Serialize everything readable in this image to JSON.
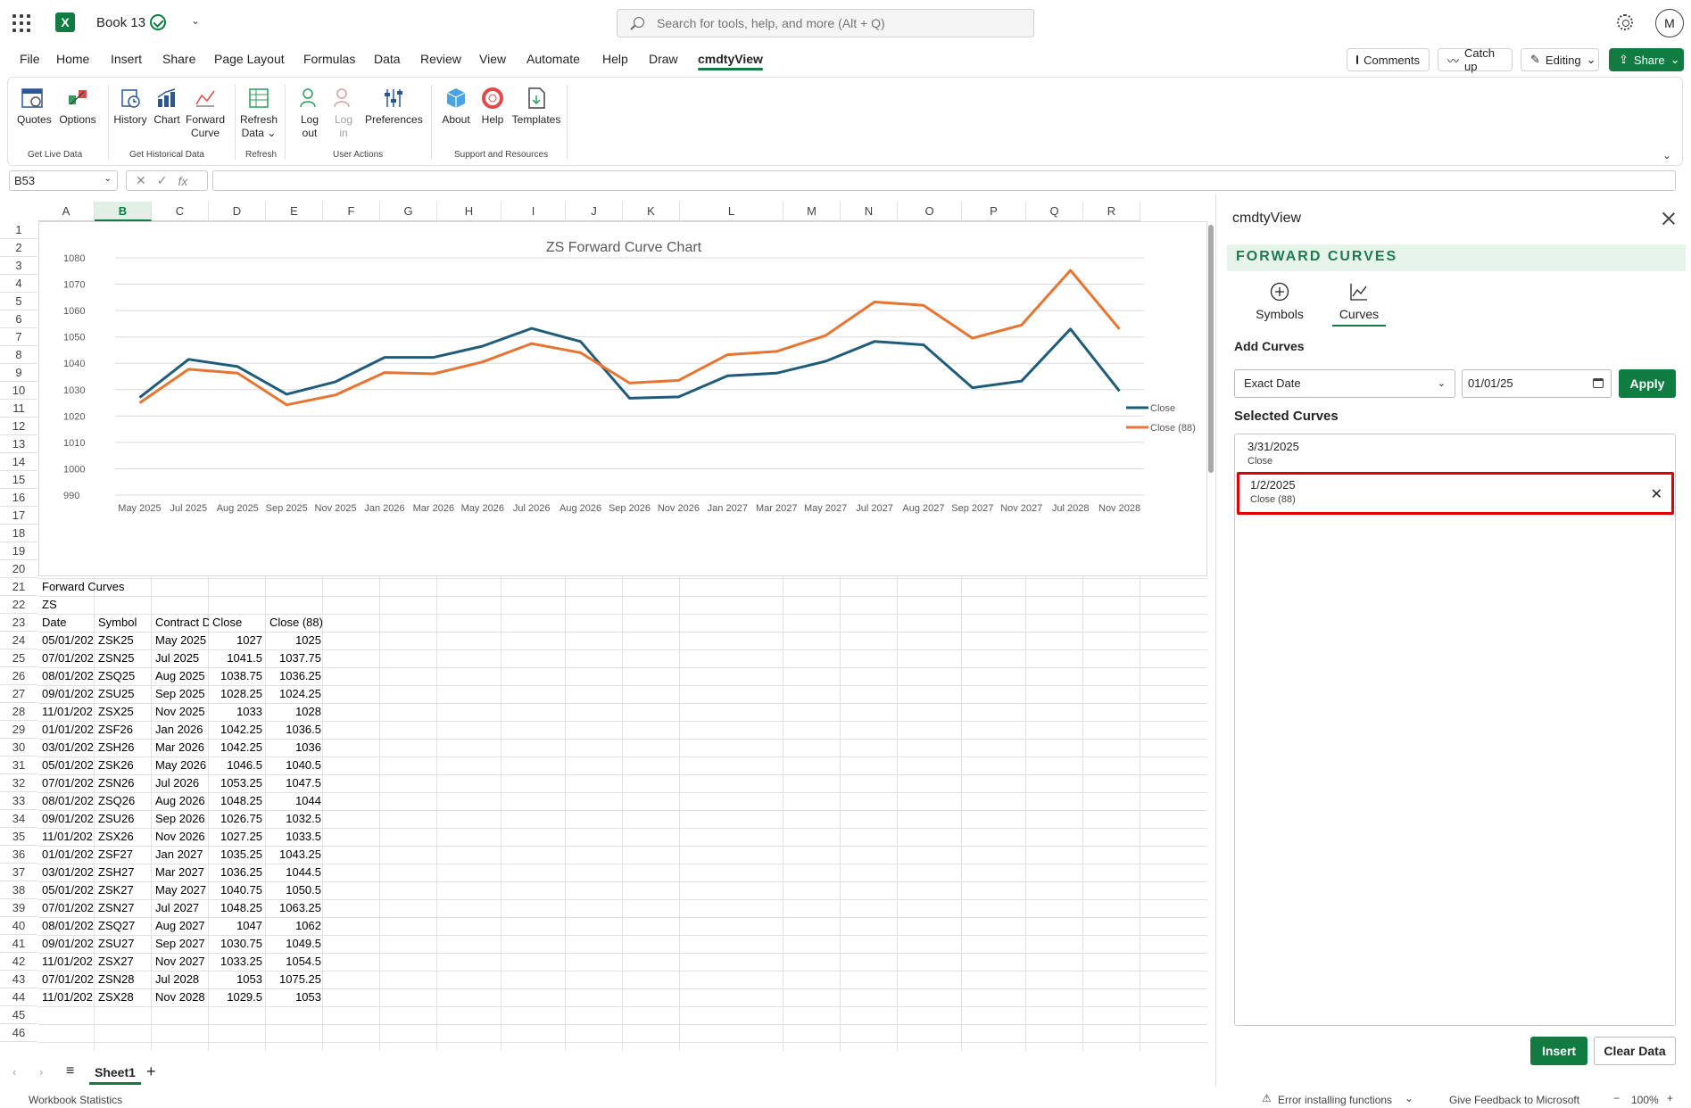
{
  "titlebar": {
    "book_title": "Book 13",
    "search_placeholder": "Search for tools, help, and more (Alt + Q)",
    "avatar_initial": "M"
  },
  "menu": {
    "tabs": [
      "File",
      "Home",
      "Insert",
      "Share",
      "Page Layout",
      "Formulas",
      "Data",
      "Review",
      "View",
      "Automate",
      "Help",
      "Draw",
      "cmdtyView"
    ],
    "active_tab": "cmdtyView",
    "comments": "Comments",
    "catch_up": "Catch up",
    "editing": "Editing",
    "share": "Share"
  },
  "ribbon": {
    "quotes": "Quotes",
    "options": "Options",
    "history": "History",
    "chart": "Chart",
    "forward": "Forward",
    "curve": "Curve",
    "refresh": "Refresh",
    "data": "Data",
    "log": "Log",
    "out": "out",
    "login_log": "Log",
    "login_in": "in",
    "preferences": "Preferences",
    "about": "About",
    "help": "Help",
    "templates": "Templates",
    "groups": {
      "live": "Get Live Data",
      "historical": "Get Historical Data",
      "refresh": "Refresh",
      "user": "User Actions",
      "support": "Support and Resources"
    }
  },
  "formula": {
    "namebox": "B53",
    "value": ""
  },
  "columns": [
    "A",
    "B",
    "C",
    "D",
    "E",
    "F",
    "G",
    "H",
    "I",
    "J",
    "K",
    "L",
    "M",
    "N",
    "O",
    "P",
    "Q",
    "R"
  ],
  "selected_column": "B",
  "sheet": {
    "row21": "Forward Curves",
    "row22": "ZS",
    "headers": [
      "Date",
      "Symbol",
      "Contract D",
      "Close",
      "Close (88)"
    ],
    "rows": [
      [
        "05/01/202",
        "ZSK25",
        "May 2025",
        "1027",
        "1025"
      ],
      [
        "07/01/202",
        "ZSN25",
        "Jul 2025",
        "1041.5",
        "1037.75"
      ],
      [
        "08/01/202",
        "ZSQ25",
        "Aug 2025",
        "1038.75",
        "1036.25"
      ],
      [
        "09/01/202",
        "ZSU25",
        "Sep 2025",
        "1028.25",
        "1024.25"
      ],
      [
        "11/01/202",
        "ZSX25",
        "Nov 2025",
        "1033",
        "1028"
      ],
      [
        "01/01/202",
        "ZSF26",
        "Jan 2026",
        "1042.25",
        "1036.5"
      ],
      [
        "03/01/202",
        "ZSH26",
        "Mar 2026",
        "1042.25",
        "1036"
      ],
      [
        "05/01/202",
        "ZSK26",
        "May 2026",
        "1046.5",
        "1040.5"
      ],
      [
        "07/01/202",
        "ZSN26",
        "Jul 2026",
        "1053.25",
        "1047.5"
      ],
      [
        "08/01/202",
        "ZSQ26",
        "Aug 2026",
        "1048.25",
        "1044"
      ],
      [
        "09/01/202",
        "ZSU26",
        "Sep 2026",
        "1026.75",
        "1032.5"
      ],
      [
        "11/01/202",
        "ZSX26",
        "Nov 2026",
        "1027.25",
        "1033.5"
      ],
      [
        "01/01/202",
        "ZSF27",
        "Jan 2027",
        "1035.25",
        "1043.25"
      ],
      [
        "03/01/202",
        "ZSH27",
        "Mar 2027",
        "1036.25",
        "1044.5"
      ],
      [
        "05/01/202",
        "ZSK27",
        "May 2027",
        "1040.75",
        "1050.5"
      ],
      [
        "07/01/202",
        "ZSN27",
        "Jul 2027",
        "1048.25",
        "1063.25"
      ],
      [
        "08/01/202",
        "ZSQ27",
        "Aug 2027",
        "1047",
        "1062"
      ],
      [
        "09/01/202",
        "ZSU27",
        "Sep 2027",
        "1030.75",
        "1049.5"
      ],
      [
        "11/01/202",
        "ZSX27",
        "Nov 2027",
        "1033.25",
        "1054.5"
      ],
      [
        "07/01/202",
        "ZSN28",
        "Jul 2028",
        "1053",
        "1075.25"
      ],
      [
        "11/01/202",
        "ZSX28",
        "Nov 2028",
        "1029.5",
        "1053"
      ]
    ]
  },
  "chart_data": {
    "type": "line",
    "title": "ZS Forward Curve Chart",
    "categories": [
      "May 2025",
      "Jul 2025",
      "Aug 2025",
      "Sep 2025",
      "Nov 2025",
      "Jan 2026",
      "Mar 2026",
      "May 2026",
      "Jul 2026",
      "Aug 2026",
      "Sep 2026",
      "Nov 2026",
      "Jan 2027",
      "Mar 2027",
      "May 2027",
      "Jul 2027",
      "Aug 2027",
      "Sep 2027",
      "Nov 2027",
      "Jul 2028",
      "Nov 2028"
    ],
    "series": [
      {
        "name": "Close",
        "color": "#1f5c7a",
        "values": [
          1027,
          1041.5,
          1038.75,
          1028.25,
          1033,
          1042.25,
          1042.25,
          1046.5,
          1053.25,
          1048.25,
          1026.75,
          1027.25,
          1035.25,
          1036.25,
          1040.75,
          1048.25,
          1047,
          1030.75,
          1033.25,
          1053,
          1029.5
        ]
      },
      {
        "name": "Close (88)",
        "color": "#e87432",
        "values": [
          1025,
          1037.75,
          1036.25,
          1024.25,
          1028,
          1036.5,
          1036,
          1040.5,
          1047.5,
          1044,
          1032.5,
          1033.5,
          1043.25,
          1044.5,
          1050.5,
          1063.25,
          1062,
          1049.5,
          1054.5,
          1075.25,
          1053
        ]
      }
    ],
    "ylim": [
      990,
      1080
    ],
    "yticks": [
      990,
      1000,
      1010,
      1020,
      1030,
      1040,
      1050,
      1060,
      1070,
      1080
    ],
    "grid": true,
    "legend": "right"
  },
  "sheet_tabs": {
    "active": "Sheet1"
  },
  "status": {
    "left": "Workbook Statistics",
    "error": "Error installing functions",
    "feedback": "Give Feedback to Microsoft",
    "zoom": "100%"
  },
  "pane": {
    "title": "cmdtyView",
    "section": "FORWARD CURVES",
    "tab_symbols": "Symbols",
    "tab_curves": "Curves",
    "add_curves": "Add Curves",
    "mode": "Exact Date",
    "date": "01/01/25",
    "apply": "Apply",
    "selected_curves": "Selected Curves",
    "curves": [
      {
        "date": "3/31/2025",
        "name": "Close"
      },
      {
        "date": "1/2/2025",
        "name": "Close (88)"
      }
    ],
    "insert": "Insert",
    "clear": "Clear Data"
  },
  "colors": {
    "accent": "#107c41",
    "highlight": "#e00000"
  }
}
